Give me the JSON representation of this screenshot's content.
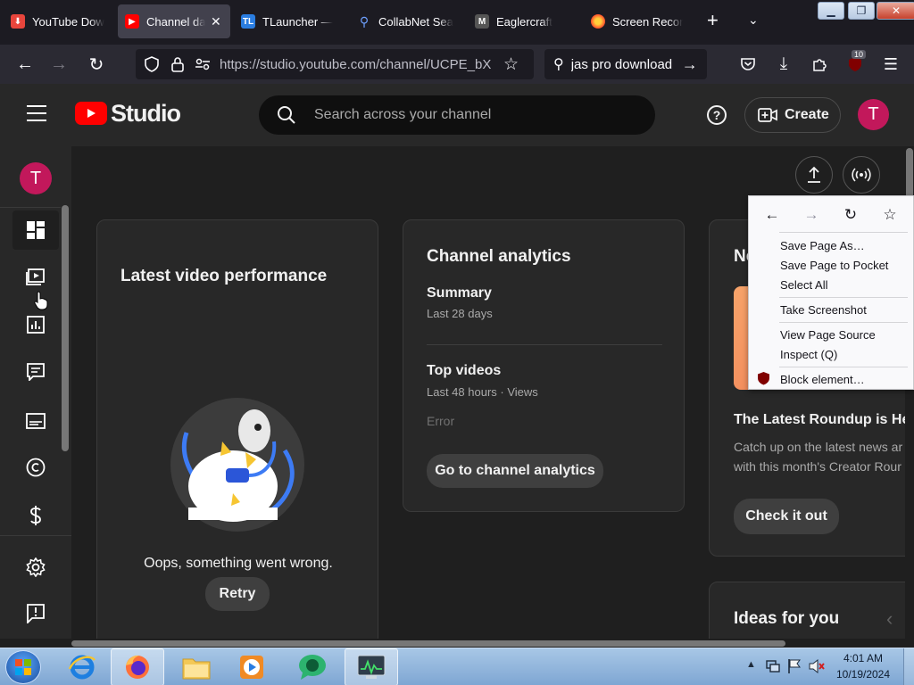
{
  "tabs": [
    {
      "title": "YouTube Dow",
      "active": false
    },
    {
      "title": "Channel da",
      "active": true
    },
    {
      "title": "TLauncher — ",
      "active": false
    },
    {
      "title": "CollabNet Sea",
      "active": false
    },
    {
      "title": "Eaglercraft",
      "active": false
    },
    {
      "title": "Screen Recor",
      "active": false
    }
  ],
  "toolbar": {
    "url": "https://studio.youtube.com/channel/UCPE_bX",
    "url_host": "studio.youtube.com",
    "search_text": "jas pro download",
    "extension_badge": "10"
  },
  "header": {
    "logo_text": "Studio",
    "search_placeholder": "Search across your channel",
    "help_icon": "?",
    "create_label": "Create",
    "avatar_letter": "T"
  },
  "sidebar": {
    "avatar_letter": "T"
  },
  "latest_video": {
    "title": "Latest video performance",
    "error_text": "Oops, something went wrong.",
    "retry_label": "Retry"
  },
  "analytics": {
    "title": "Channel analytics",
    "summary_label": "Summary",
    "summary_period": "Last 28 days",
    "top_videos_label": "Top videos",
    "top_videos_period": "Last 48 hours · Views",
    "error_label": "Error",
    "button_label": "Go to channel analytics"
  },
  "news": {
    "title_partial": "Ne",
    "headline": "The Latest Roundup is He",
    "body_line1": "Catch up on the latest news ar",
    "body_line2": "with this month's Creator Rour",
    "button_label": "Check it out"
  },
  "ideas": {
    "title": "Ideas for you"
  },
  "context_menu": {
    "items": [
      "Save Page As…",
      "Save Page to Pocket",
      "Select All",
      "Take Screenshot",
      "View Page Source",
      "Inspect (Q)",
      "Block element…"
    ]
  },
  "taskbar": {
    "time": "4:01 AM",
    "date": "10/19/2024"
  },
  "colors": {
    "youtube_red": "#ff0000",
    "avatar": "#c2185b",
    "firefox_dark": "#1c1b22"
  }
}
